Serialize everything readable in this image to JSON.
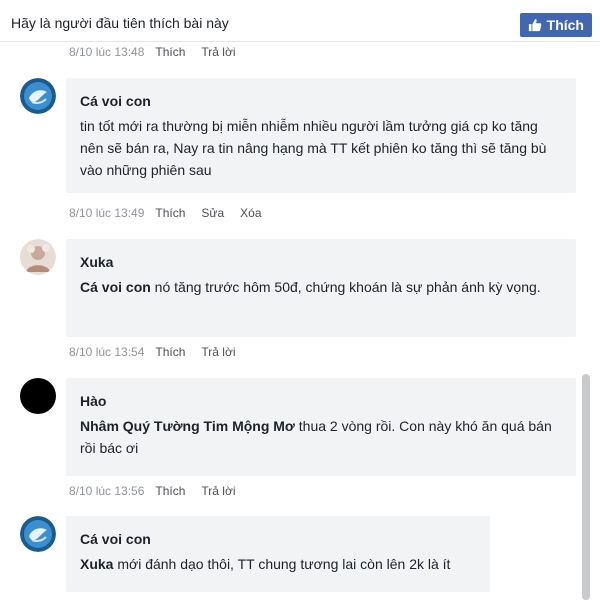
{
  "header": {
    "prompt": "Hãy là người đầu tiên thích bài này",
    "like_label": "Thích"
  },
  "first_meta": {
    "time": "8/10 lúc 13:48",
    "like": "Thích",
    "reply": "Trả lời"
  },
  "comments": [
    {
      "author": "Cá voi con",
      "mention": "",
      "text": "tin tốt mới ra thường bị miễn nhiễm nhiều người lầm tưởng giá cp ko tăng nên sẽ bán ra, Nay ra tin nâng hạng mà TT kết phiên ko tăng thì sẽ tăng bù vào những phiên sau",
      "time": "8/10 lúc 13:49",
      "actions": [
        "Thích",
        "Sửa",
        "Xóa"
      ]
    },
    {
      "author": "Xuka",
      "mention": "Cá voi con",
      "text": " nó tăng trước hôm 50đ, chứng khoán là sự phản ánh kỳ vọng.",
      "time": "8/10 lúc 13:54",
      "actions": [
        "Thích",
        "Trả lời"
      ]
    },
    {
      "author": "Hào",
      "mention": "Nhâm Quý Tường Tim Mộng Mơ",
      "text": " thua 2 vòng rồi. Con này khó ăn quá bán rồi bác ơi",
      "time": "8/10 lúc 13:56",
      "actions": [
        "Thích",
        "Trả lời"
      ]
    },
    {
      "author": "Cá voi con",
      "mention": "Xuka",
      "text": " mới đánh dạo thôi, TT chung tương lai còn lên 2k là ít",
      "time": "",
      "actions": []
    }
  ],
  "colors": {
    "like_button": "#4267b2",
    "bubble": "#f2f3f5",
    "meta": "#90949c"
  }
}
